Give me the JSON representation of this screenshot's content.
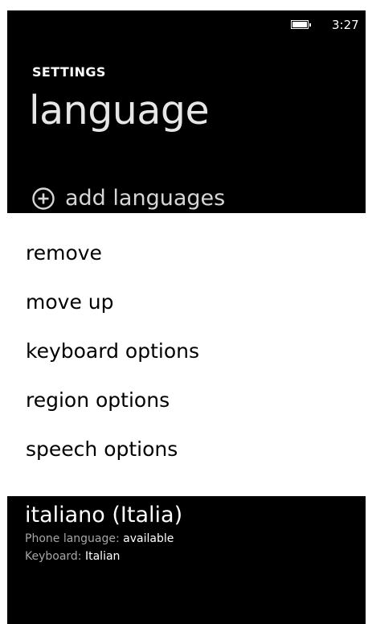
{
  "status_bar": {
    "time": "3:27",
    "battery_level": 1.0,
    "battery_icon": "battery-icon"
  },
  "header": {
    "app_title": "SETTINGS",
    "page_title": "language"
  },
  "add_languages": {
    "icon": "plus-circle-icon",
    "label": "add languages"
  },
  "context_menu": {
    "items": [
      {
        "label": "remove"
      },
      {
        "label": "move up"
      },
      {
        "label": "keyboard options"
      },
      {
        "label": "region options"
      },
      {
        "label": "speech options"
      }
    ]
  },
  "language_entry": {
    "name": "italiano (Italia)",
    "phone_language_label": "Phone language:",
    "phone_language_value": "available",
    "keyboard_label": "Keyboard:",
    "keyboard_value": "Italian"
  },
  "colors": {
    "background": "#000000",
    "menu_background": "#ffffff",
    "menu_text": "#000000",
    "text_primary": "#ffffff",
    "text_secondary": "#a6a6a6"
  }
}
